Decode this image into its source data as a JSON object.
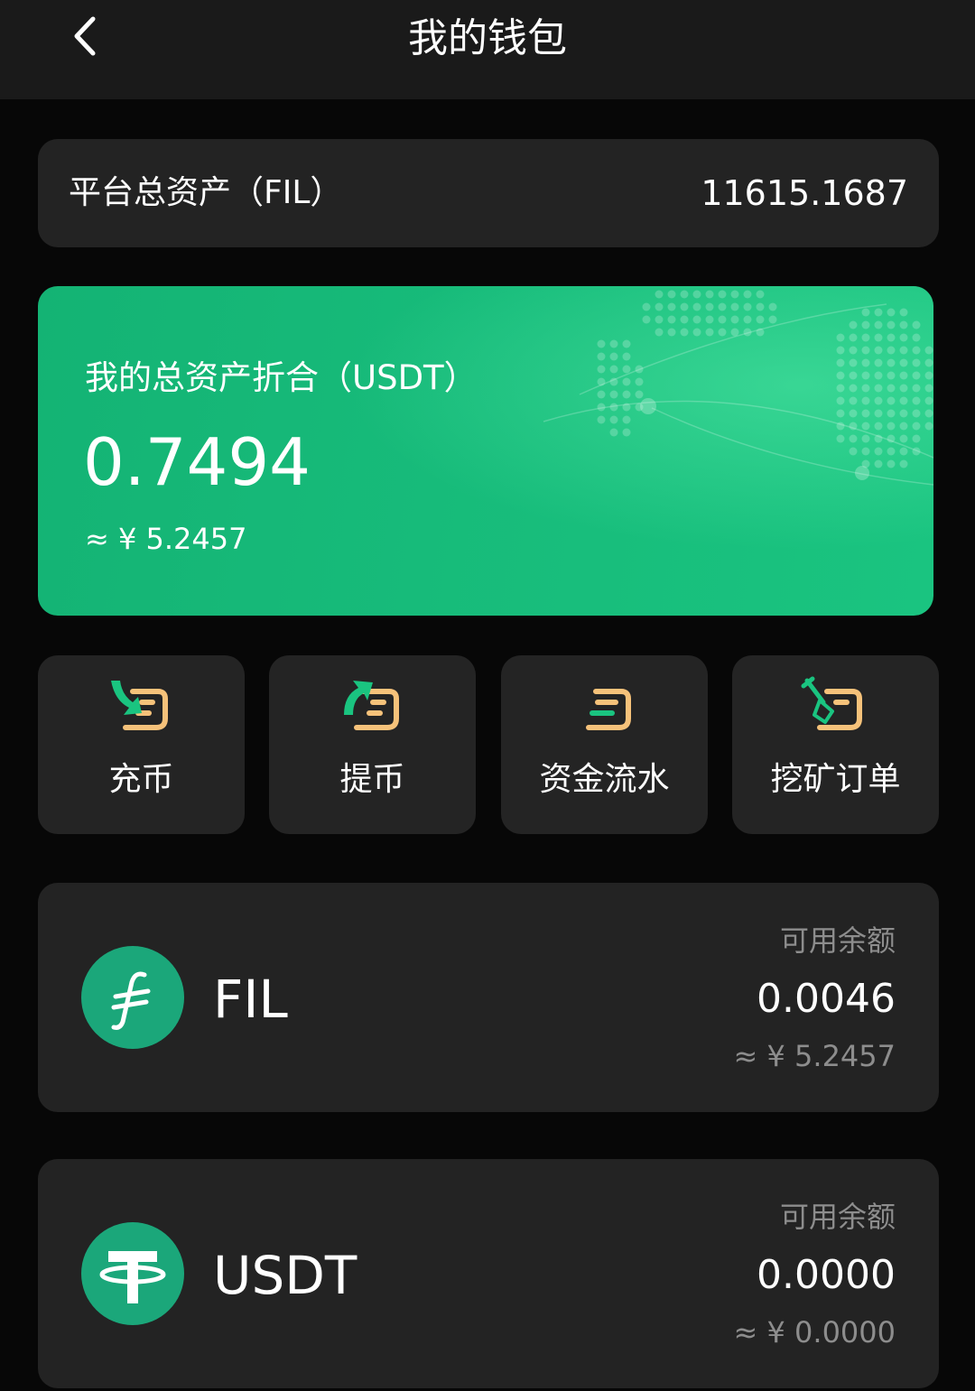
{
  "header": {
    "title": "我的钱包"
  },
  "platform_total": {
    "label": "平台总资产（FIL）",
    "value": "11615.1687"
  },
  "usdt_card": {
    "label": "我的总资产折合（USDT）",
    "value": "0.7494",
    "cny": "≈ ¥ 5.2457"
  },
  "actions": [
    {
      "label": "充币",
      "icon": "deposit-icon"
    },
    {
      "label": "提币",
      "icon": "withdraw-icon"
    },
    {
      "label": "资金流水",
      "icon": "fund-flow-icon"
    },
    {
      "label": "挖矿订单",
      "icon": "mining-order-icon"
    }
  ],
  "assets": [
    {
      "name": "FIL",
      "avail_label": "可用余额",
      "balance": "0.0046",
      "cny": "≈ ¥ 5.2457",
      "icon": "fil-logo-icon"
    },
    {
      "name": "USDT",
      "avail_label": "可用余额",
      "balance": "0.0000",
      "cny": "≈ ¥ 0.0000",
      "icon": "usdt-logo-icon"
    }
  ],
  "colors": {
    "accent": "#1ac480",
    "card": "#232323",
    "wallet_orange": "#f6c27a"
  }
}
